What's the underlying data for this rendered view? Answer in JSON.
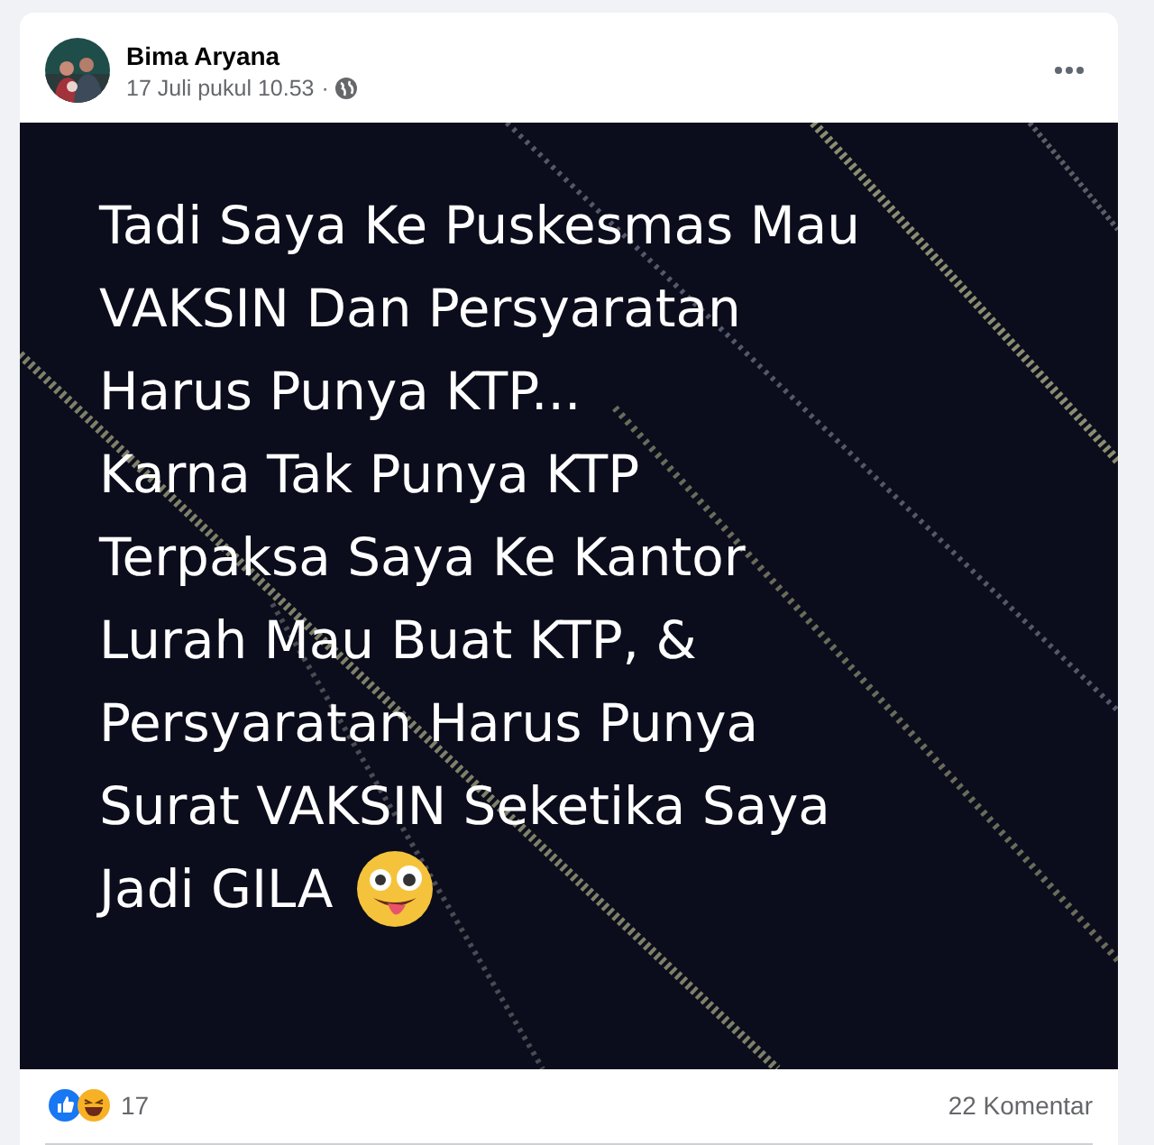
{
  "post": {
    "author": "Bima Aryana",
    "timestamp": "17 Juli pukul 10.53",
    "separator": "·",
    "image_text": [
      "Tadi Saya Ke Puskesmas Mau",
      "VAKSIN Dan Persyaratan",
      "Harus Punya KTP...",
      "Karna Tak Punya KTP",
      "Terpaksa Saya Ke Kantor",
      "Lurah Mau Buat KTP, &",
      "Persyaratan Harus Punya",
      "Surat VAKSIN Seketika Saya",
      "Jadi GILA"
    ],
    "reaction_count": "17",
    "comment_count": "22 Komentar"
  }
}
